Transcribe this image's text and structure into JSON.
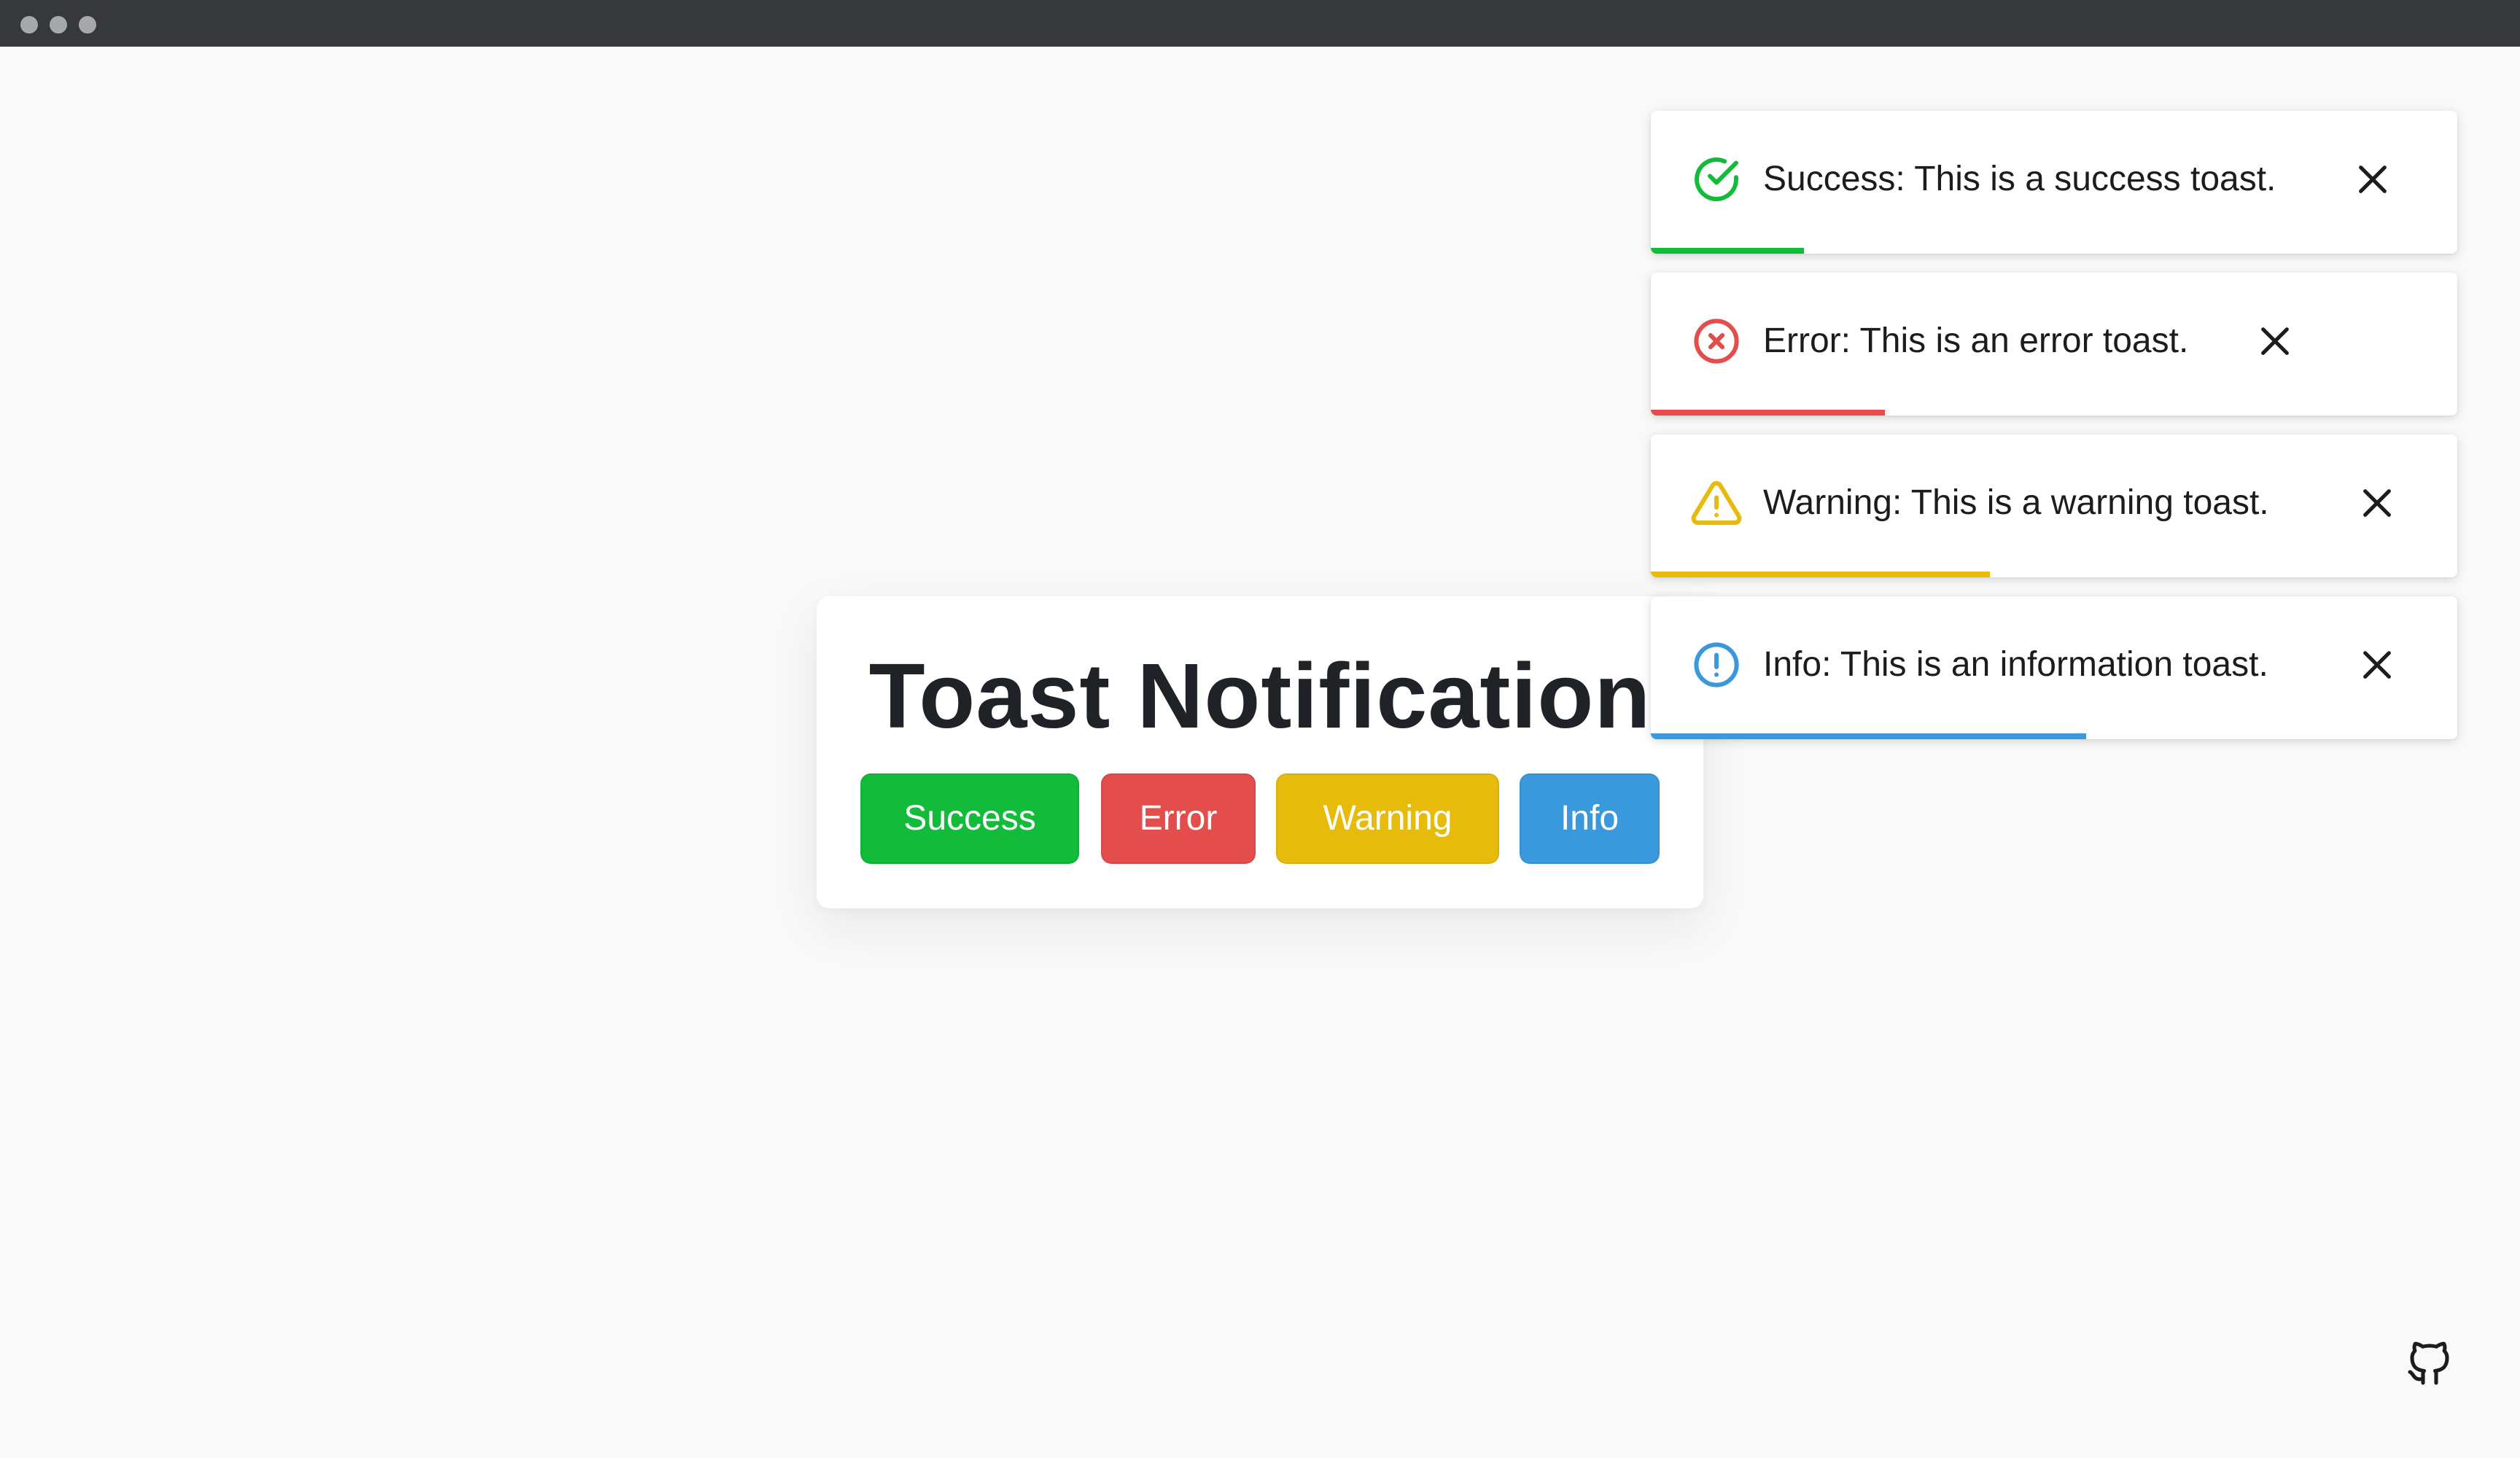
{
  "title": "Toast Notification",
  "buttons": {
    "success": "Success",
    "error": "Error",
    "warning": "Warning",
    "info": "Info"
  },
  "toasts": [
    {
      "type": "success",
      "icon": "check-circle-icon",
      "message": "Success: This is a success toast.",
      "color": "#12bc3a",
      "progress": 0.19
    },
    {
      "type": "error",
      "icon": "x-circle-icon",
      "message": "Error: This is an error toast.",
      "color": "#e34d4c",
      "progress": 0.29
    },
    {
      "type": "warning",
      "icon": "warning-triangle-icon",
      "message": "Warning: This is a warning toast.",
      "color": "#e7bb0c",
      "progress": 0.42
    },
    {
      "type": "info",
      "icon": "info-circle-icon",
      "message": "Info: This is an information toast.",
      "color": "#3a99dd",
      "progress": 0.54
    }
  ],
  "colors": {
    "background": "#f9f9f9",
    "titlebar": "#37383b",
    "success": "#12bc3a",
    "error": "#e34d4c",
    "warning": "#e7bb0c",
    "info": "#3a99dd"
  },
  "footer_icon": "github-icon"
}
